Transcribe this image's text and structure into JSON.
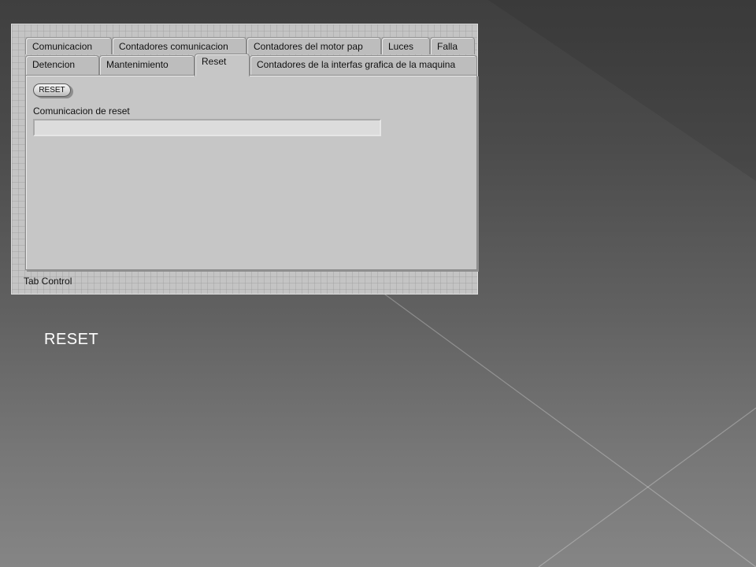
{
  "tab_control": {
    "tabs_row1": [
      {
        "label": "Comunicacion"
      },
      {
        "label": "Contadores comunicacion"
      },
      {
        "label": "Contadores del motor pap"
      },
      {
        "label": "Luces"
      },
      {
        "label": "Falla"
      }
    ],
    "tabs_row2": [
      {
        "label": "Detencion"
      },
      {
        "label": "Mantenimiento"
      },
      {
        "label": "Reset"
      },
      {
        "label": "Contadores de la interfas grafica de la maquina"
      }
    ],
    "active_tab": "Reset",
    "caption": "Tab Control"
  },
  "reset_page": {
    "reset_button_label": "RESET",
    "string_label": "Comunicacion de reset",
    "string_value": ""
  },
  "slide": {
    "caption": "RESET"
  },
  "colors": {
    "panel_background": "#c4c4c4",
    "tab_background": "#bdbdbd",
    "slide_text": "#ffffff"
  }
}
